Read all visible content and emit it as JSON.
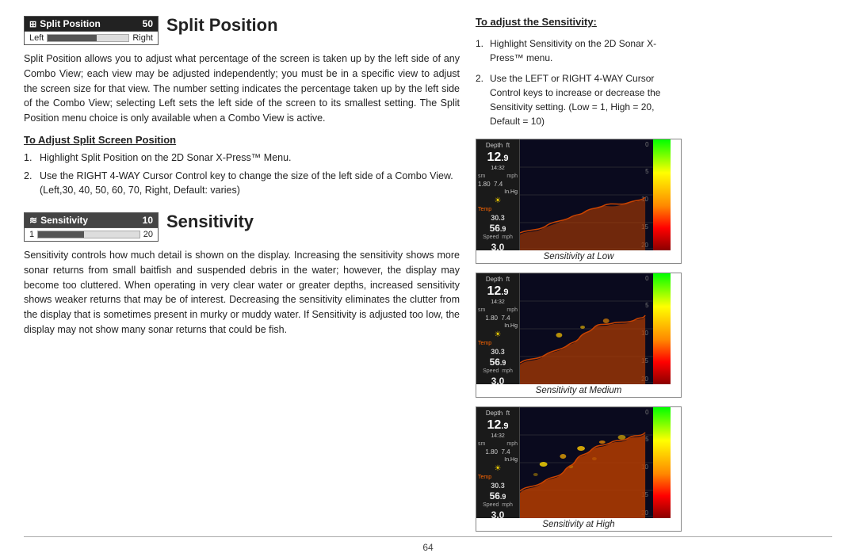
{
  "page": {
    "footer_page_number": "64"
  },
  "split_position": {
    "section_title": "Split Position",
    "widget_label": "Split Position",
    "widget_icon": "⊞",
    "widget_value": "50",
    "widget_left_label": "Left",
    "widget_right_label": "Right",
    "body_text": "Split Position allows you to adjust what percentage of the screen is taken up by the left side of any Combo View; each view may be adjusted independently; you must be in a specific view to adjust the screen size for that view. The number setting indicates the percentage taken up by the left side of the Combo View; selecting Left sets the left side of the screen to its smallest setting. The Split Position menu choice is only available when a Combo View is active.",
    "subsection_title": "To Adjust Split Screen Position",
    "step1": "Highlight Split Position on the 2D Sonar X-Press™ Menu.",
    "step2": "Use the RIGHT 4-WAY Cursor Control key to change the size of the left side of a Combo View. (Left,30, 40, 50, 60, 70, Right, Default: varies)"
  },
  "sensitivity": {
    "section_title": "Sensitivity",
    "widget_label": "Sensitivity",
    "widget_icon": "≋",
    "widget_value": "10",
    "widget_min": "1",
    "widget_max": "20",
    "body_text": "Sensitivity controls how much detail is shown on the display. Increasing the sensitivity shows more sonar returns from small baitfish and suspended debris in the water; however, the display may become too cluttered. When operating in very clear water or greater depths, increased sensitivity shows weaker returns that may be of interest. Decreasing the sensitivity eliminates the clutter from the display that is sometimes present in murky or muddy water. If Sensitivity is adjusted too low, the display may not show many sonar returns that could be fish."
  },
  "right_panel": {
    "heading": "To adjust the Sensitivity:",
    "step1": "Highlight Sensitivity on the 2D Sonar X-Press™ menu.",
    "step2": "Use the LEFT or RIGHT 4-WAY Cursor Control keys to increase or decrease the Sensitivity setting. (Low = 1, High = 20, Default = 10)",
    "sonar_low_caption": "Sensitivity at Low",
    "sonar_med_caption": "Sensitivity at Medium",
    "sonar_high_caption": "Sensitivity at High",
    "sonar_depth": "12",
    "sonar_depth_decimal": ".9",
    "sonar_time": "14:32",
    "sonar_units1": "sm",
    "sonar_units2": "mph",
    "sonar_val1": "1.80",
    "sonar_val2": "7.4",
    "sonar_in_hg": "In.Hg",
    "sonar_temp_label": "Temp",
    "sonar_temp_val": "30.3",
    "sonar_speed_val": "56",
    "sonar_speed_dec": ".9",
    "sonar_speed_unit": "mph",
    "sonar_bottom_val": "3.0",
    "depth_marks": [
      "0",
      "5",
      "10",
      "15",
      "20"
    ]
  }
}
